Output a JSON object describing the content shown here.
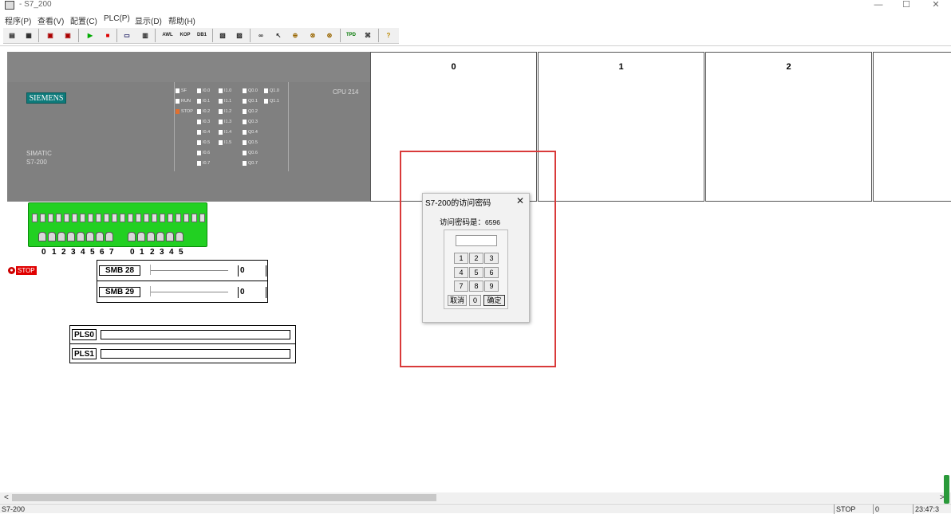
{
  "window": {
    "title": "- S7_200",
    "icon": "s7-app-icon",
    "minimize": "—",
    "maximize": "☐",
    "close": "✕"
  },
  "menu": [
    {
      "label": "程序(P)"
    },
    {
      "label": "查看(V)"
    },
    {
      "label": "配置(C)"
    },
    {
      "label": "PLC(P)"
    },
    {
      "label": "显示(D)"
    },
    {
      "label": "帮助(H)"
    }
  ],
  "toolbar": {
    "buttons": [
      {
        "name": "open-program-icon",
        "glyph": "▤"
      },
      {
        "name": "save-program-icon",
        "glyph": "▦"
      },
      {
        "name": "load-plc-icon",
        "glyph": "▣"
      },
      {
        "name": "upload-plc-icon",
        "glyph": "▣"
      },
      {
        "name": "run-icon",
        "glyph": "▶"
      },
      {
        "name": "stop-icon",
        "glyph": "■"
      },
      {
        "name": "monitor-icon",
        "glyph": "▭"
      },
      {
        "name": "printer-icon",
        "glyph": "▥"
      },
      {
        "name": "awl-button",
        "glyph": "AWL"
      },
      {
        "name": "kop-button",
        "glyph": "KOP"
      },
      {
        "name": "db1-button",
        "glyph": "DB1"
      },
      {
        "name": "state-table-icon",
        "glyph": "▧"
      },
      {
        "name": "chart-icon",
        "glyph": "▨"
      },
      {
        "name": "glasses-icon",
        "glyph": "∞"
      },
      {
        "name": "pointer-icon",
        "glyph": "↖"
      },
      {
        "name": "lock-icon",
        "glyph": "⊕"
      },
      {
        "name": "lock-open-icon",
        "glyph": "⊗"
      },
      {
        "name": "lock-arrow-icon",
        "glyph": "⊛"
      },
      {
        "name": "tpd-icon",
        "glyph": "TPD"
      },
      {
        "name": "network-icon",
        "glyph": "⌘"
      },
      {
        "name": "help-icon",
        "glyph": "?"
      }
    ]
  },
  "plc": {
    "logo": "SIEMENS",
    "brand_line1": "SIMATIC",
    "brand_line2": "S7-200",
    "model": "CPU 214",
    "status_leds": [
      {
        "label": "SF",
        "on": false
      },
      {
        "label": "RUN",
        "on": false
      },
      {
        "label": "STOP",
        "on": true
      }
    ],
    "status_on_color": "#e07030",
    "inputs0": [
      "I0.0",
      "I0.1",
      "I0.2",
      "I0.3",
      "I0.4",
      "I0.5",
      "I0.6",
      "I0.7"
    ],
    "inputs1": [
      "I1.0",
      "I1.1",
      "I1.2",
      "I1.3",
      "I1.4",
      "I1.5"
    ],
    "outputs0": [
      "Q0.0",
      "Q0.1",
      "Q0.2",
      "Q0.3",
      "Q0.4",
      "Q0.5",
      "Q0.6",
      "Q0.7"
    ],
    "outputs1": [
      "Q1.0",
      "Q1.1"
    ]
  },
  "slots": [
    {
      "label": "0"
    },
    {
      "label": "1"
    },
    {
      "label": "2"
    },
    {
      "label": ""
    }
  ],
  "terminal": {
    "digits_group1": [
      "0",
      "1",
      "2",
      "3",
      "4",
      "5",
      "6",
      "7"
    ],
    "digits_group2": [
      "0",
      "1",
      "2",
      "3",
      "4",
      "5"
    ]
  },
  "run_state": {
    "label": "STOP"
  },
  "smb": [
    {
      "label": "SMB 28",
      "value": "0",
      "level": 0
    },
    {
      "label": "SMB 29",
      "value": "0",
      "level": 0
    }
  ],
  "pls": [
    {
      "label": "PLS0"
    },
    {
      "label": "PLS1"
    }
  ],
  "dialog": {
    "title": "S7-200的访问密码",
    "close": "✕",
    "message": "访问密码是：",
    "code": "6596",
    "password_value": "",
    "keys_row1": [
      "1",
      "2",
      "3"
    ],
    "keys_row2": [
      "4",
      "5",
      "6"
    ],
    "keys_row3": [
      "7",
      "8",
      "9"
    ],
    "cancel": "取消",
    "zero": "0",
    "ok": "确定"
  },
  "scrollbar": {
    "left": "<",
    "right": ">"
  },
  "statusbar": {
    "program": "S7-200",
    "state": "STOP",
    "value": "0",
    "time": "23:47:3"
  }
}
